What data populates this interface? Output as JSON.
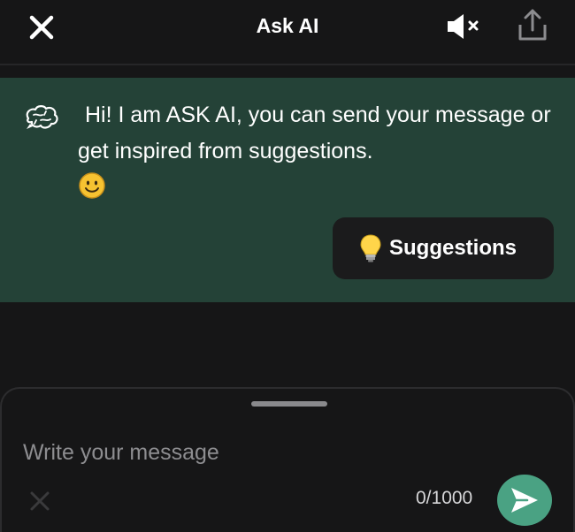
{
  "header": {
    "title": "Ask AI",
    "close_icon": "close-icon",
    "mute_icon": "volume-mute-icon",
    "share_icon": "share-upload-icon"
  },
  "message": {
    "text": "Hi! I am ASK AI, you can send your message or get inspired from suggestions.",
    "avatar_icon": "brain-icon",
    "emoji_icon": "smiley-emoji-icon"
  },
  "suggestions": {
    "label": "Suggestions",
    "icon": "lightbulb-icon"
  },
  "composer": {
    "placeholder": "Write your message",
    "value": "",
    "counter": "0/1000",
    "clear_icon": "clear-icon",
    "send_icon": "send-icon"
  },
  "colors": {
    "background": "#161617",
    "message_bg": "#244237",
    "button_bg": "#1b1b1c",
    "accent": "#4aa283"
  }
}
